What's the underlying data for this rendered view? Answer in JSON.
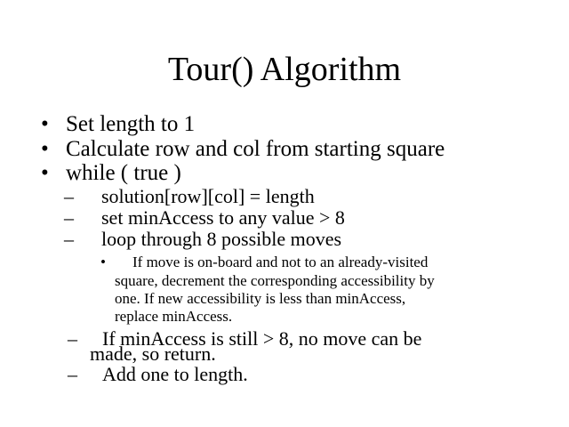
{
  "slide": {
    "title": "Tour() Algorithm",
    "level1": [
      {
        "bullet": "•",
        "text": "Set length to 1"
      },
      {
        "bullet": "•",
        "text": "Calculate row and col from starting square"
      },
      {
        "bullet": "•",
        "text": "while ( true )"
      }
    ],
    "level2": [
      {
        "bullet": "–",
        "text": "solution[row][col] = length"
      },
      {
        "bullet": "–",
        "text": "set minAccess to any value > 8"
      },
      {
        "bullet": "–",
        "text": "loop through 8 possible moves"
      }
    ],
    "level3": {
      "bullet": "•",
      "lines": [
        "If move is on-board and not to an already-visited",
        "square, decrement the corresponding accessibility by",
        "one.  If new accessibility is less than minAccess,",
        "replace minAccess."
      ]
    },
    "level2_after": [
      {
        "bullet": "–",
        "lines": [
          "If minAccess is still > 8, no move can be",
          "made, so return."
        ]
      },
      {
        "bullet": "–",
        "lines": [
          "Add one to length."
        ]
      }
    ]
  }
}
